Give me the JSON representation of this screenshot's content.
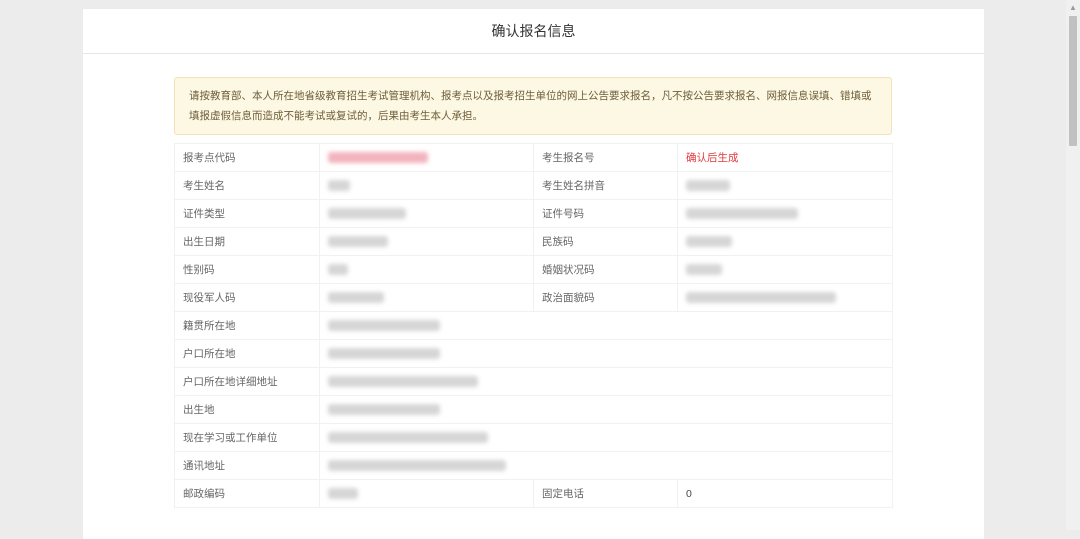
{
  "page_title": "确认报名信息",
  "notice_text": "请按教育部、本人所在地省级教育招生考试管理机构、报考点以及报考招生单位的网上公告要求报名，凡不按公告要求报名、网报信息误填、错填或填报虚假信息而造成不能考试或复试的，后果由考生本人承担。",
  "fields": {
    "exam_site_code": "报考点代码",
    "registration_no": "考生报名号",
    "registration_no_value": "确认后生成",
    "name": "考生姓名",
    "name_pinyin": "考生姓名拼音",
    "id_type": "证件类型",
    "id_number": "证件号码",
    "birth_date": "出生日期",
    "ethnicity_code": "民族码",
    "gender_code": "性别码",
    "marital_code": "婚姻状况码",
    "military_code": "现役军人码",
    "political_code": "政治面貌码",
    "native_place": "籍贯所在地",
    "hukou_location": "户口所在地",
    "hukou_address": "户口所在地详细地址",
    "birthplace": "出生地",
    "work_unit": "现在学习或工作单位",
    "mailing_address": "通讯地址",
    "postal_code": "邮政编码",
    "landline": "固定电话",
    "landline_value": "0"
  },
  "scrollbar": {
    "up_icon": "arrow-up-icon",
    "down_icon": "arrow-down-icon"
  }
}
